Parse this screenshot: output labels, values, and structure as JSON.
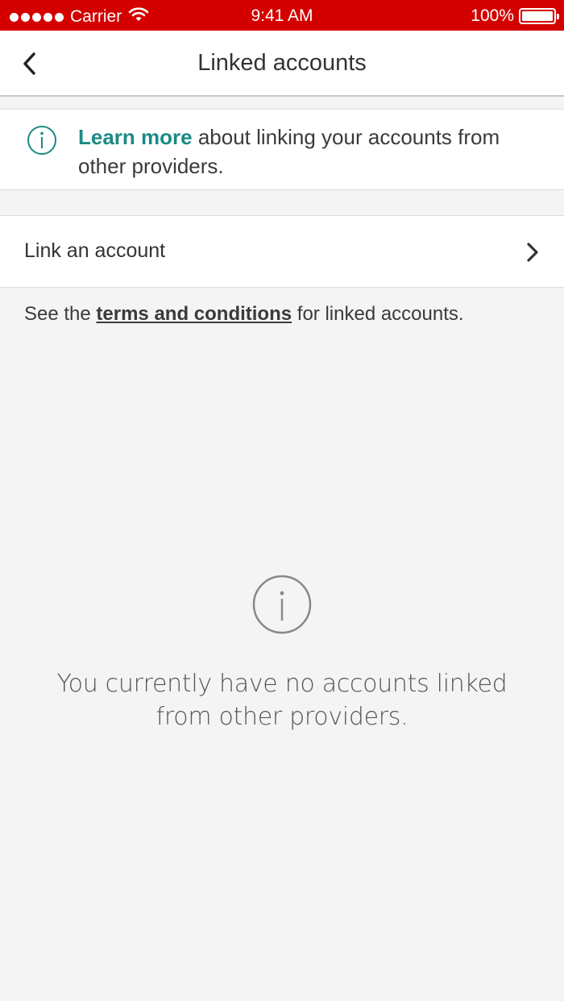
{
  "status_bar": {
    "carrier": "Carrier",
    "time": "9:41 AM",
    "battery": "100%"
  },
  "nav": {
    "title": "Linked accounts",
    "back_icon": "chevron-left-icon"
  },
  "info_banner": {
    "icon": "info-icon",
    "learn_more": "Learn more",
    "text": " about linking your accounts from other providers."
  },
  "link_row": {
    "label": "Link an account",
    "icon": "chevron-right-icon"
  },
  "terms": {
    "prefix": "See the ",
    "link": "terms and conditions",
    "suffix": " for linked accounts."
  },
  "empty_state": {
    "icon": "info-icon",
    "message": "You currently have no accounts linked from other providers."
  },
  "colors": {
    "status_bar": "#d40000",
    "accent": "#1c8a84",
    "background": "#f4f4f4"
  }
}
